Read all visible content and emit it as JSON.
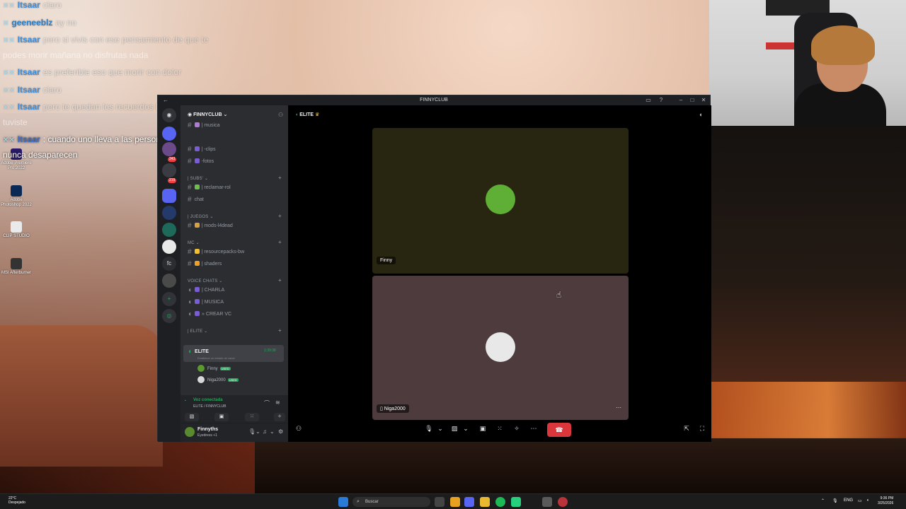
{
  "chat": [
    {
      "user": "Itsaar",
      "text": "claro",
      "faded": true
    },
    {
      "user": "geeneeblz",
      "text": "ay no",
      "faded": true
    },
    {
      "user": "Itsaar",
      "text": "pero si vivis con ese pensamiento de que te",
      "faded": true
    },
    {
      "cont": "podes morir mañana no disfrutas nada",
      "faded": true
    },
    {
      "user": "Itsaar",
      "text": "es preferible eso que morir con dolor",
      "faded": true
    },
    {
      "user": "Itsaar",
      "text": "claro",
      "faded": true
    },
    {
      "user": "Itsaar",
      "text": "pero te quedan los recuerdos lindos que",
      "faded": true,
      "highlight_tail": "recuerdos lindos que"
    },
    {
      "cont": "tuviste",
      "faded": true
    },
    {
      "user": "Itsaar",
      "text": ": cuando uno lleva a las personas en el corazon",
      "highlight": true
    },
    {
      "cont": "nunca desaparecen",
      "highlight": true
    }
  ],
  "desktop_icons": [
    {
      "label": "Adobe Premiere Pro 2022",
      "color": "#2a1a6a"
    },
    {
      "label": "Adobe Photoshop 2022",
      "color": "#0a2a55"
    },
    {
      "label": "CLIP STUDIO",
      "color": "#eaeaea"
    },
    {
      "label": "MSI Afterburner",
      "color": "#333333"
    }
  ],
  "window": {
    "title": "FINNYCLUB"
  },
  "server": {
    "name": "FINNYCLUB",
    "badge_counts": [
      "243",
      "219"
    ],
    "guild_label": "fc"
  },
  "channels": {
    "top": [
      {
        "name": "| musica",
        "color": "#b07ad8"
      },
      {
        "name": "| -clips",
        "color": "#7a5cd8"
      },
      {
        "name": "-fotos",
        "color": "#7a5cd8"
      }
    ],
    "cat_subs": "| SUBS'",
    "subs": [
      {
        "name": "| reclamar-rol",
        "color": "#6cc04a"
      },
      {
        "name": "chat",
        "color": ""
      }
    ],
    "cat_juegos": "| JUEGOS",
    "juegos": [
      {
        "name": "| mods-l4dead",
        "color": "#d8a040"
      }
    ],
    "cat_mc": "MC",
    "mc": [
      {
        "name": "| resourcepacks-bw",
        "color": "#f0c030"
      },
      {
        "name": "| shaders",
        "color": "#f0a020"
      }
    ],
    "cat_voice": "VOICE CHATS",
    "voice": [
      {
        "name": "| CHARLA",
        "color": "#7a5cd8"
      },
      {
        "name": "| MUSICA",
        "color": "#7a5cd8"
      },
      {
        "name": "» CREAR VC",
        "color": "#7a5cd8"
      }
    ],
    "cat_elite": "| ELITE",
    "active_vc": {
      "name": "ELITE",
      "timer": "1:39:38",
      "status": "Establece un estado de canal"
    },
    "members": [
      {
        "name": "Finny",
        "badge": "USED",
        "color": "#5a9a2e"
      },
      {
        "name": "Niga2000",
        "badge": "USED",
        "color": "#d8d8d8"
      }
    ]
  },
  "voice_panel": {
    "status": "Voz conectada",
    "sub": "ELITE / FINNYCLUB"
  },
  "user_panel": {
    "name": "Finnyths",
    "status": "Eyedress +1"
  },
  "stage": {
    "channel": "ELITE",
    "tiles": [
      {
        "name": "Finny",
        "bg": "#282510",
        "avatar": "#5fae35"
      },
      {
        "name": "Niga2000",
        "bg": "#4d3b3d",
        "avatar": "#e8e8e8"
      }
    ]
  },
  "taskbar": {
    "weather_temp": "22°C",
    "weather_desc": "Despejado",
    "search": "Buscar",
    "lang": "ENG",
    "time": "9:36 PM",
    "date": "3/25/2026"
  }
}
